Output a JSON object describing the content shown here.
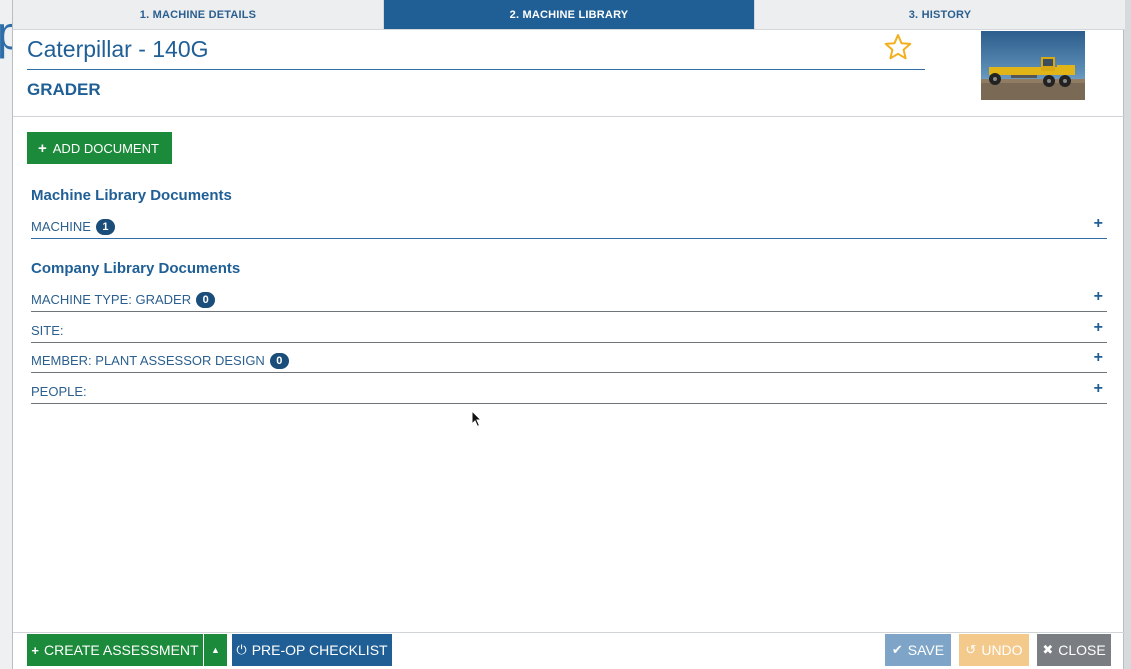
{
  "background": {
    "letter": "p"
  },
  "tabs": [
    {
      "label": "1. MACHINE DETAILS",
      "active": false
    },
    {
      "label": "2. MACHINE LIBRARY",
      "active": true
    },
    {
      "label": "3. HISTORY",
      "active": false
    }
  ],
  "header": {
    "title": "Caterpillar - 140G",
    "subtitle": "GRADER",
    "favorite_icon": "star-outline-icon"
  },
  "actions": {
    "add_document": "ADD DOCUMENT"
  },
  "machine_library": {
    "title": "Machine Library Documents",
    "rows": [
      {
        "label": "MACHINE",
        "count": "1"
      }
    ]
  },
  "company_library": {
    "title": "Company Library Documents",
    "rows": [
      {
        "label": "MACHINE TYPE: GRADER",
        "count": "0"
      },
      {
        "label": "SITE:",
        "count": null
      },
      {
        "label": "MEMBER: PLANT ASSESSOR DESIGN",
        "count": "0"
      },
      {
        "label": "PEOPLE:",
        "count": null
      }
    ]
  },
  "footer": {
    "create_assessment": "CREATE ASSESSMENT",
    "pre_op_checklist": "PRE-OP CHECKLIST",
    "save": "SAVE",
    "undo": "UNDO",
    "close": "CLOSE"
  },
  "colors": {
    "primary": "#1f5f96",
    "green": "#1b8a3a",
    "star": "#f2b01e",
    "save_disabled": "#7ea5c8",
    "undo_disabled": "#f4c98c",
    "close": "#7a7e82"
  }
}
